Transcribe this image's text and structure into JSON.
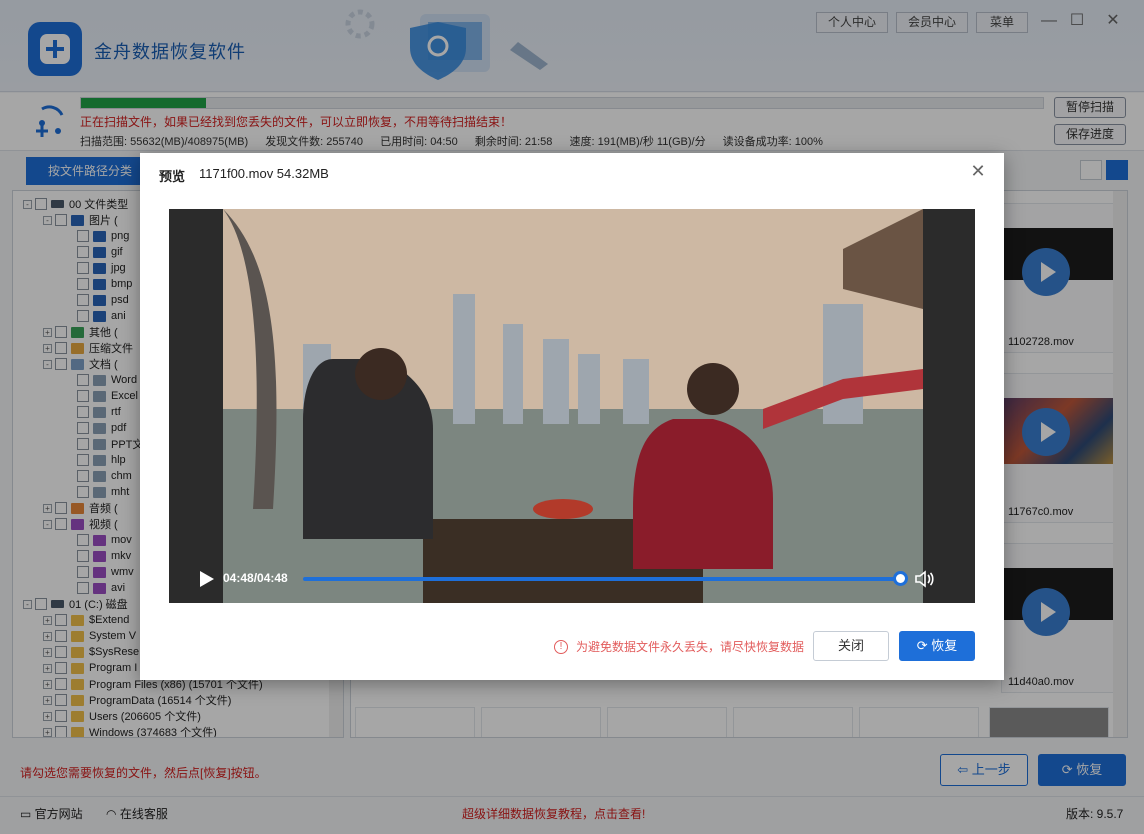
{
  "app": {
    "title": "金舟数据恢复软件",
    "top_buttons": [
      "个人中心",
      "会员中心",
      "菜单"
    ],
    "version": "版本: 9.5.7"
  },
  "scan": {
    "progress": 0.13,
    "message": "正在扫描文件，如果已经找到您丢失的文件，可以立即恢复，不用等待扫描结束！",
    "range": "扫描范围: 55632(MB)/408975(MB)",
    "found": "发现文件数: 255740",
    "elapsed": "已用时间: 04:50",
    "remaining": "剩余时间: 21:58",
    "speed": "速度: 191(MB)/秒  11(GB)/分",
    "success_rate": "读设备成功率: 100%",
    "pause_label": "暂停扫描",
    "save_label": "保存进度"
  },
  "tabs": {
    "active": "按文件路径分类"
  },
  "tree": [
    {
      "label": "00 文件类型",
      "depth": 0,
      "expander": "−",
      "icon": "drive"
    },
    {
      "label": "图片",
      "depth": 1,
      "expander": "−",
      "icon": "img",
      "suffix": "("
    },
    {
      "label": "png",
      "depth": 2,
      "icon": "img"
    },
    {
      "label": "gif",
      "depth": 2,
      "icon": "img"
    },
    {
      "label": "jpg",
      "depth": 2,
      "icon": "img"
    },
    {
      "label": "bmp",
      "depth": 2,
      "icon": "img"
    },
    {
      "label": "psd",
      "depth": 2,
      "icon": "img"
    },
    {
      "label": "ani",
      "depth": 2,
      "icon": "img"
    },
    {
      "label": "其他",
      "depth": 1,
      "expander": "+",
      "icon": "green",
      "suffix": "("
    },
    {
      "label": "压缩文件",
      "depth": 1,
      "expander": "+",
      "icon": "zip"
    },
    {
      "label": "文档",
      "depth": 1,
      "expander": "−",
      "icon": "doc",
      "suffix": "("
    },
    {
      "label": "Word",
      "depth": 2,
      "icon": "grey"
    },
    {
      "label": "Excel",
      "depth": 2,
      "icon": "grey"
    },
    {
      "label": "rtf",
      "depth": 2,
      "icon": "grey"
    },
    {
      "label": "pdf",
      "depth": 2,
      "icon": "grey"
    },
    {
      "label": "PPT文",
      "depth": 2,
      "icon": "grey"
    },
    {
      "label": "hlp",
      "depth": 2,
      "icon": "grey"
    },
    {
      "label": "chm",
      "depth": 2,
      "icon": "grey"
    },
    {
      "label": "mht",
      "depth": 2,
      "icon": "grey"
    },
    {
      "label": "音频",
      "depth": 1,
      "expander": "+",
      "icon": "audio",
      "suffix": "("
    },
    {
      "label": "视频",
      "depth": 1,
      "expander": "−",
      "icon": "video",
      "suffix": "("
    },
    {
      "label": "mov",
      "depth": 2,
      "icon": "video"
    },
    {
      "label": "mkv",
      "depth": 2,
      "icon": "video"
    },
    {
      "label": "wmv",
      "depth": 2,
      "icon": "video"
    },
    {
      "label": "avi",
      "depth": 2,
      "icon": "video"
    },
    {
      "label": "01 (C:) 磁盘",
      "depth": 0,
      "expander": "−",
      "icon": "drive"
    },
    {
      "label": "$Extend",
      "depth": 1,
      "expander": "+",
      "icon": "folder"
    },
    {
      "label": "System V",
      "depth": 1,
      "expander": "+",
      "icon": "folder"
    },
    {
      "label": "$SysRese",
      "depth": 1,
      "expander": "+",
      "icon": "folder"
    },
    {
      "label": "Program I",
      "depth": 1,
      "expander": "+",
      "icon": "folder"
    },
    {
      "label": "Program Files (x86)     (15701 个文件)",
      "depth": 1,
      "expander": "+",
      "icon": "folder"
    },
    {
      "label": "ProgramData     (16514 个文件)",
      "depth": 1,
      "expander": "+",
      "icon": "folder"
    },
    {
      "label": "Users     (206605 个文件)",
      "depth": 1,
      "expander": "+",
      "icon": "folder"
    },
    {
      "label": "Windows     (374683 个文件)",
      "depth": 1,
      "expander": "+",
      "icon": "folder"
    }
  ],
  "thumbs": [
    {
      "name": "1102728.mov",
      "kind": "dark"
    },
    {
      "name": "11767c0.mov",
      "kind": "image"
    },
    {
      "name": "11d40a0.mov",
      "kind": "dark"
    }
  ],
  "bottom": {
    "hint": "请勾选您需要恢复的文件，然后点[恢复]按钮。",
    "prev_label": "上一步",
    "recover_label": "恢复",
    "site_label": "官方网站",
    "service_label": "在线客服",
    "promo": "超级详细数据恢复教程，点击查看!"
  },
  "preview": {
    "title": "预览",
    "file": "1171f00.mov 54.32MB",
    "time": "04:48/04:48",
    "position": 1.0,
    "warning": "为避免数据文件永久丢失，请尽快恢复数据",
    "close_label": "关闭",
    "recover_label": "恢复"
  },
  "colors": {
    "accent": "#1e6fd9",
    "progress": "#1fa447",
    "alert": "#d32020"
  }
}
